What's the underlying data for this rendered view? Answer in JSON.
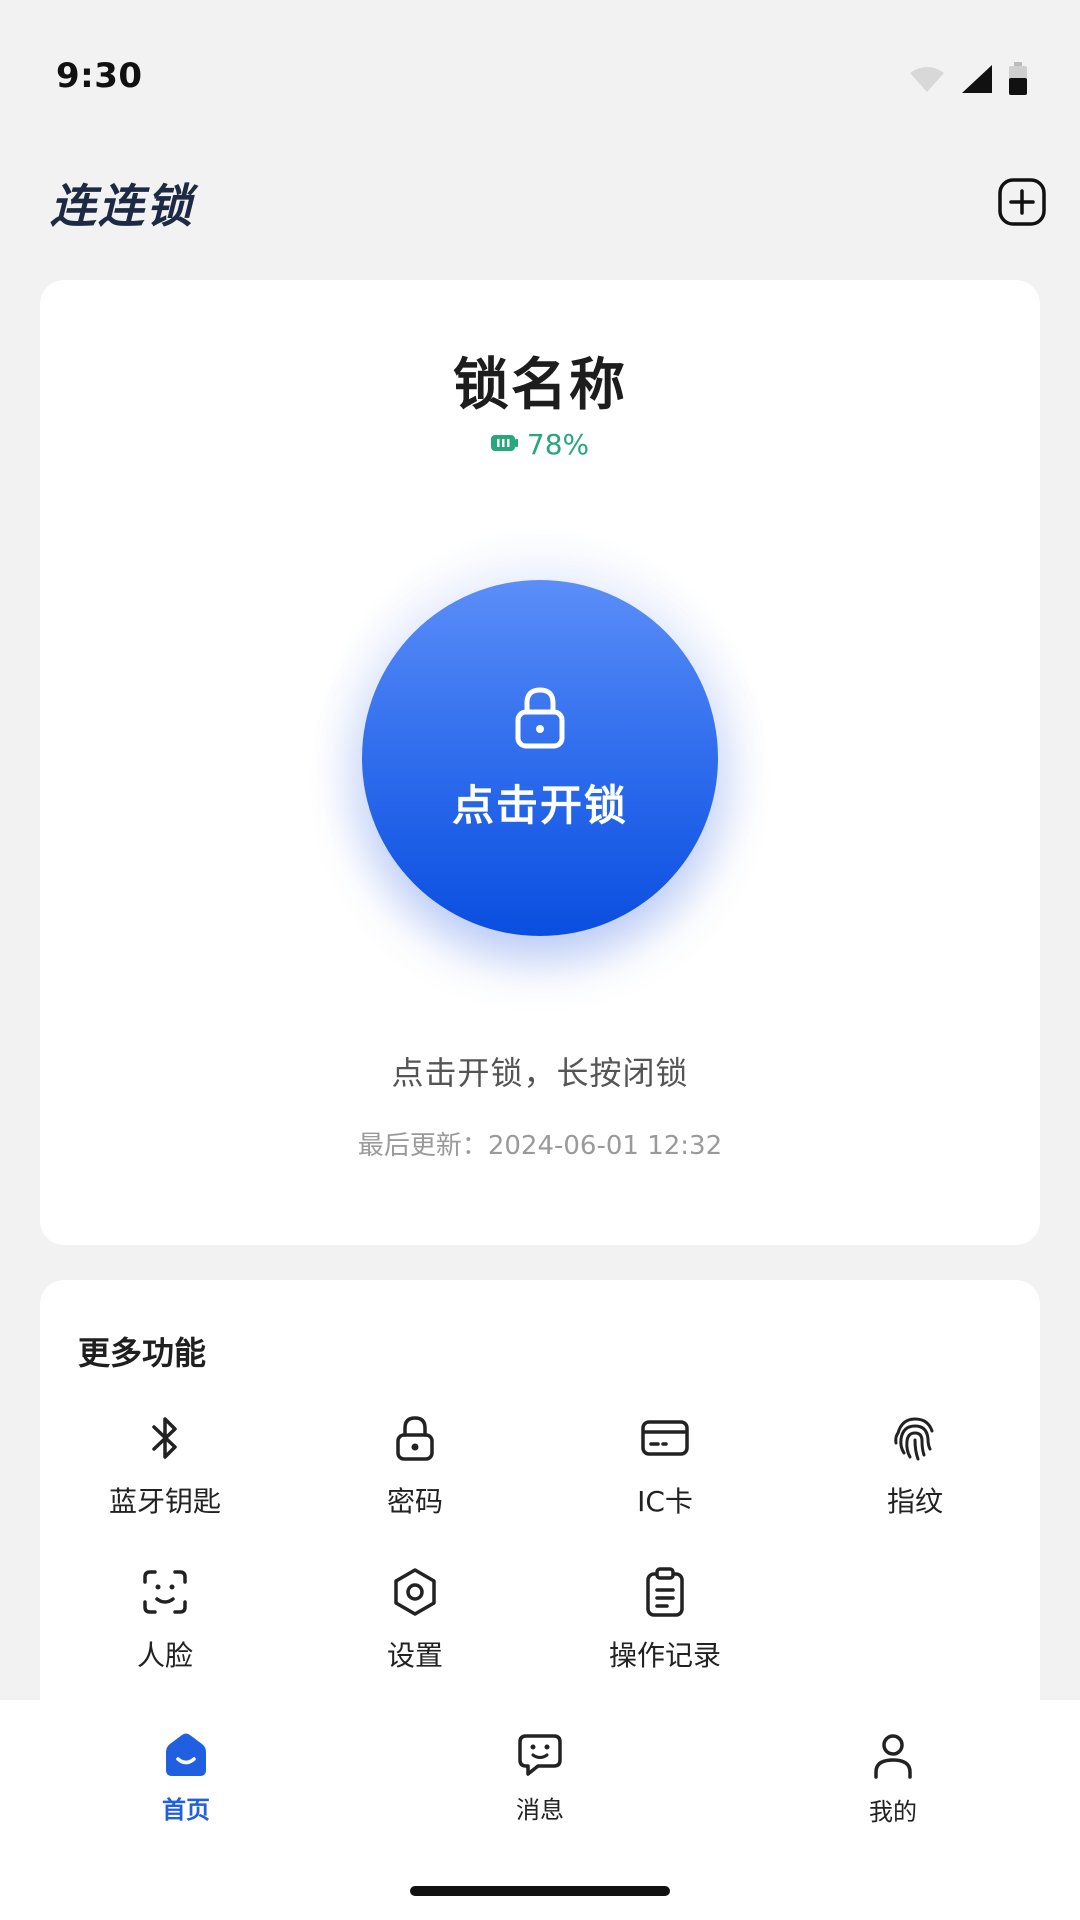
{
  "status_bar": {
    "time": "9:30",
    "icons": [
      "wifi-icon",
      "signal-icon",
      "battery-icon"
    ]
  },
  "header": {
    "app_title": "连连锁",
    "add_icon": "plus-square-icon"
  },
  "lock_card": {
    "lock_name": "锁名称",
    "battery_percent": "78%",
    "battery_color": "#27a77a",
    "unlock_label": "点击开锁",
    "hint": "点击开锁，长按闭锁",
    "last_update": "最后更新：2024-06-01 12:32",
    "accent_color": "#2f6ded"
  },
  "features": {
    "title": "更多功能",
    "items": [
      {
        "label": "蓝牙钥匙",
        "icon": "bluetooth-icon"
      },
      {
        "label": "密码",
        "icon": "lock-icon"
      },
      {
        "label": "IC卡",
        "icon": "card-icon"
      },
      {
        "label": "指纹",
        "icon": "fingerprint-icon"
      },
      {
        "label": "人脸",
        "icon": "face-scan-icon"
      },
      {
        "label": "设置",
        "icon": "settings-hexagon-icon"
      },
      {
        "label": "操作记录",
        "icon": "clipboard-icon"
      }
    ]
  },
  "bottom_nav": {
    "items": [
      {
        "label": "首页",
        "icon": "home-icon",
        "active": true
      },
      {
        "label": "消息",
        "icon": "message-icon",
        "active": false
      },
      {
        "label": "我的",
        "icon": "user-icon",
        "active": false
      }
    ]
  }
}
